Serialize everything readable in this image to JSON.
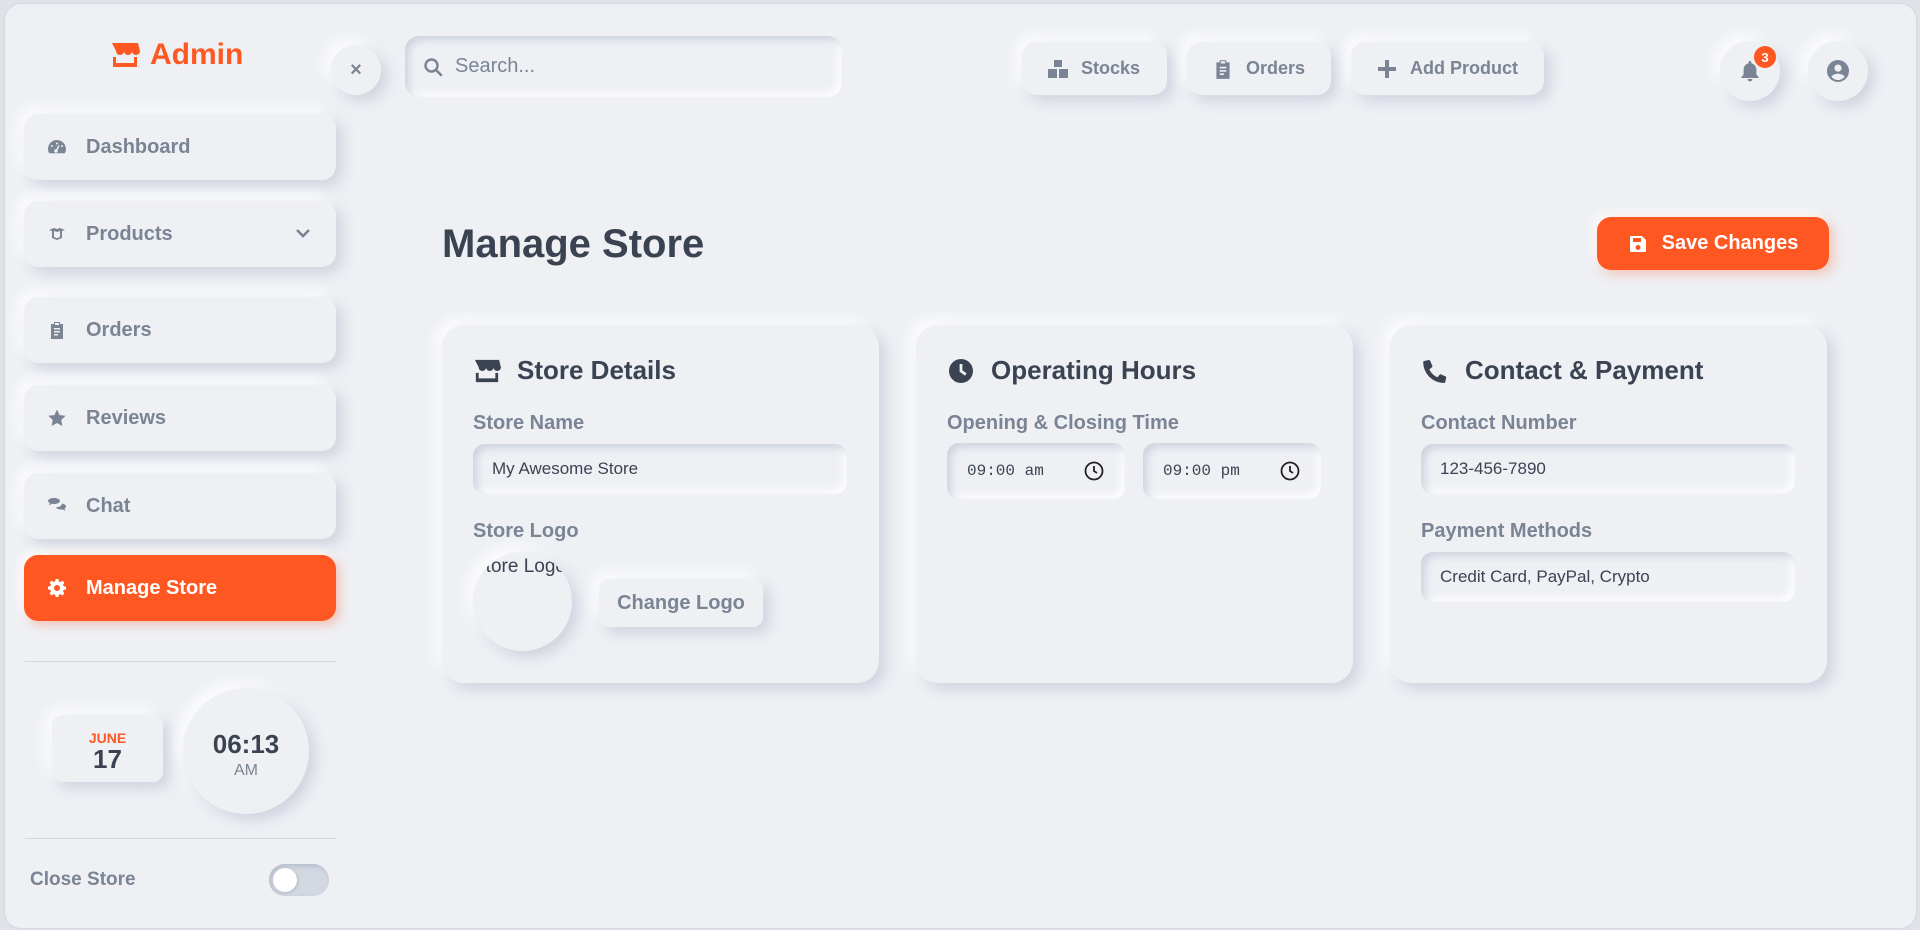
{
  "brand": {
    "name": "Admin",
    "icon": "store-icon",
    "color": "#ff5722"
  },
  "sidebar": {
    "items": [
      {
        "label": "Dashboard",
        "icon": "gauge-icon"
      },
      {
        "label": "Products",
        "icon": "boxes-icon"
      },
      {
        "label": "Orders",
        "icon": "clipboard-icon"
      },
      {
        "label": "Reviews",
        "icon": "star-icon"
      },
      {
        "label": "Chat",
        "icon": "comments-icon"
      },
      {
        "label": "Manage Store",
        "icon": "gear-icon",
        "active": true
      }
    ],
    "date": {
      "month": "JUNE",
      "day": "17"
    },
    "clock": {
      "time": "06:13",
      "ampm": "AM"
    },
    "close_store": {
      "label": "Close Store",
      "on": false
    }
  },
  "topbar": {
    "close_label": "×",
    "search_placeholder": "Search...",
    "buttons": [
      {
        "label": "Stocks",
        "icon": "boxes-stacked-icon"
      },
      {
        "label": "Orders",
        "icon": "clipboard-icon"
      },
      {
        "label": "Add Product",
        "icon": "plus-icon"
      }
    ],
    "notifications": {
      "count": "3",
      "icon": "bell-icon"
    },
    "account_icon": "user-circle-icon"
  },
  "main": {
    "title": "Manage Store",
    "save_label": "Save Changes",
    "store_details": {
      "title": "Store Details",
      "store_name_label": "Store Name",
      "store_name_value": "My Awesome Store",
      "store_logo_label": "Store Logo",
      "logo_alt": "Store Logo",
      "change_logo_label": "Change Logo"
    },
    "operating_hours": {
      "title": "Operating Hours",
      "time_label": "Opening & Closing Time",
      "opening": "09:00 am",
      "closing": "09:00 pm"
    },
    "contact_payment": {
      "title": "Contact & Payment",
      "contact_label": "Contact Number",
      "contact_value": "123-456-7890",
      "payment_label": "Payment Methods",
      "payment_value": "Credit Card, PayPal, Crypto"
    }
  },
  "colors": {
    "accent": "#ff5722",
    "background": "#eef0f4",
    "text": "#3b4352",
    "muted": "#7b8494"
  }
}
